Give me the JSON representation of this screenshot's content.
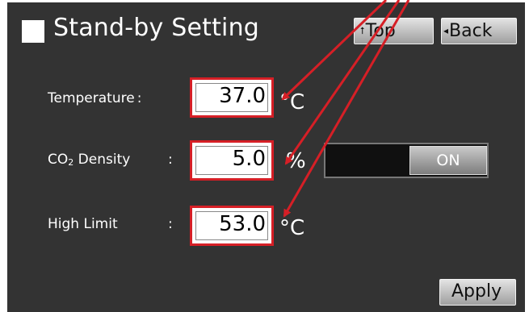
{
  "header": {
    "title": "Stand-by Setting",
    "top_label": "Top",
    "back_label": "Back"
  },
  "fields": [
    {
      "label": "Temperature",
      "colon": ":",
      "value": "37.0",
      "unit": "°C"
    },
    {
      "label_main": "CO",
      "label_sub": "2",
      "label_rest": " Density",
      "colon": ":",
      "value": "5.0",
      "unit": "%"
    },
    {
      "label": "High Limit",
      "colon": ":",
      "value": "53.0",
      "unit": "°C"
    }
  ],
  "co2_toggle": {
    "state_label": "ON"
  },
  "footer": {
    "apply_label": "Apply"
  },
  "colors": {
    "background": "#333333",
    "highlight": "#d61f26",
    "button": "#c8c8c8"
  }
}
